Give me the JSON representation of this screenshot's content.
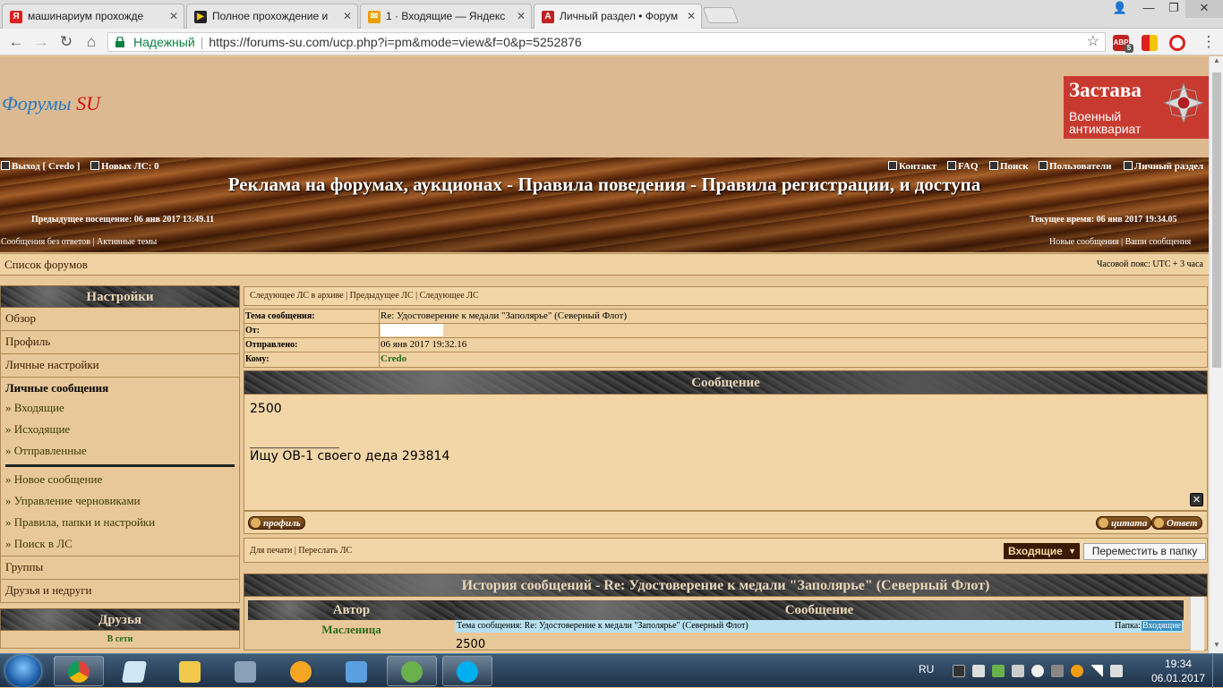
{
  "browser": {
    "tabs": [
      {
        "title": "машинариум прохожде",
        "favicon": "yandex-icon",
        "favcolor": "#e02020",
        "letter": "Я"
      },
      {
        "title": "Полное прохождение и",
        "favicon": "play-icon",
        "favcolor": "#222",
        "letter": "▶"
      },
      {
        "title": "1 · Входящие — Яндекс",
        "favicon": "mail-icon",
        "favcolor": "#e8a000",
        "letter": "✉"
      },
      {
        "title": "Личный раздел • Форум",
        "favicon": "forum-icon",
        "favcolor": "#c02020",
        "letter": "A"
      }
    ],
    "address": {
      "secure_label": "Надежный",
      "url": "https://forums-su.com/ucp.php?i=pm&mode=view&f=0&p=5252876"
    },
    "ext_abp_count": "5"
  },
  "site": {
    "logo_main": "Форумы",
    "logo_accent": "SU",
    "ad": {
      "title": "Застава",
      "line1": "Военный",
      "line2": "антиквариат"
    }
  },
  "header": {
    "logout": "Выход [ Credo ]",
    "new_pm": "Новых ЛС: 0",
    "right_links": [
      "Контакт",
      "FAQ",
      "Поиск",
      "Пользователи",
      "Личный раздел"
    ],
    "title": "Реклама на форумах, аукционах - Правила поведения - Правила регистрации, и доступа",
    "last_visit": "Предыдущее посещение: 06 янв 2017 13:49.11",
    "current_time": "Текущее время: 06 янв 2017 19:34.05",
    "left_links": "Сообщения без ответов  |  Активные темы",
    "right_links2": "Новые сообщения  |  Ваши сообщения"
  },
  "navbar": {
    "crumb": "Список форумов",
    "timezone": "Часовой пояс: UTC + 3 часа"
  },
  "sidebar": {
    "heading": "Настройки",
    "items_top": [
      "Обзор",
      "Профиль",
      "Личные настройки"
    ],
    "pm_title": "Личные сообщения",
    "pm_folders": [
      "» Входящие",
      "» Исходящие",
      "» Отправленные"
    ],
    "pm_actions": [
      "» Новое сообщение",
      "» Управление черновиками",
      "» Правила, папки и настройки",
      "» Поиск в ЛС"
    ],
    "items_bottom": [
      "Группы",
      "Друзья и недруги"
    ],
    "friends_heading": "Друзья",
    "friends_online": "В сети"
  },
  "pm": {
    "nav": "Следующее ЛС в архиве  |  Предыдущее ЛС  |  Следующее ЛС",
    "fields": [
      {
        "key": "Тема сообщения:",
        "value": "Re: Удостоверение к медали \"Заполярье\" (Северный Флот)"
      },
      {
        "key": "От:",
        "value": ""
      },
      {
        "key": "Отправлено:",
        "value": "06 янв 2017 19:32.16"
      },
      {
        "key": "Кому:",
        "value": "Credo"
      }
    ],
    "message_heading": "Сообщение",
    "body_line1": "2500",
    "body_sig_rule": "____________________",
    "body_sig": "Ищу ОВ-1 своего деда 293814",
    "btn_profile": "профиль",
    "btn_quote": "цитата",
    "btn_reply": "Ответ",
    "actions": "Для печати  |  Переслать ЛС",
    "folder_selected": "Входящие",
    "move_button": "Переместить в папку"
  },
  "history": {
    "title": "История сообщений - Re: Удостоверение к медали \"Заполярье\" (Северный Флот)",
    "col_author": "Автор",
    "col_message": "Сообщение",
    "author": "Масленица",
    "subject": "Тема сообщения: Re: Удостоверение к медали \"Заполярье\" (Северный Флот)",
    "folder_label": "Папка:",
    "folder_name": "Входящие",
    "body": "2500"
  },
  "taskbar": {
    "lang": "RU",
    "time": "19:34",
    "date": "06.01.2017"
  }
}
